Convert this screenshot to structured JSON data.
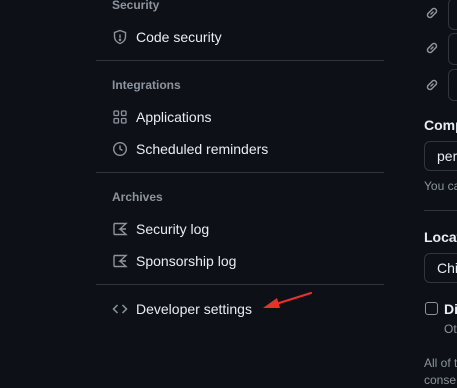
{
  "sidebar": {
    "security_heading": "Security",
    "code_security": "Code security",
    "integrations_heading": "Integrations",
    "applications": "Applications",
    "scheduled_reminders": "Scheduled reminders",
    "archives_heading": "Archives",
    "security_log": "Security log",
    "sponsorship_log": "Sponsorship log",
    "developer_settings": "Developer settings"
  },
  "profile_form": {
    "company_label": "Comp",
    "company_value": "per",
    "company_note": "You ca",
    "location_label": "Locat",
    "location_value": "Chi",
    "checkbox_label": "Di",
    "checkbox_note": "Ot",
    "footer_line1": "All of t",
    "footer_line2": "conse"
  },
  "annotation": {
    "arrow_color": "#e5332a"
  },
  "colors": {
    "background": "#0d1117",
    "text": "#e6edf3",
    "muted": "#8b949e",
    "border": "#30363d"
  }
}
